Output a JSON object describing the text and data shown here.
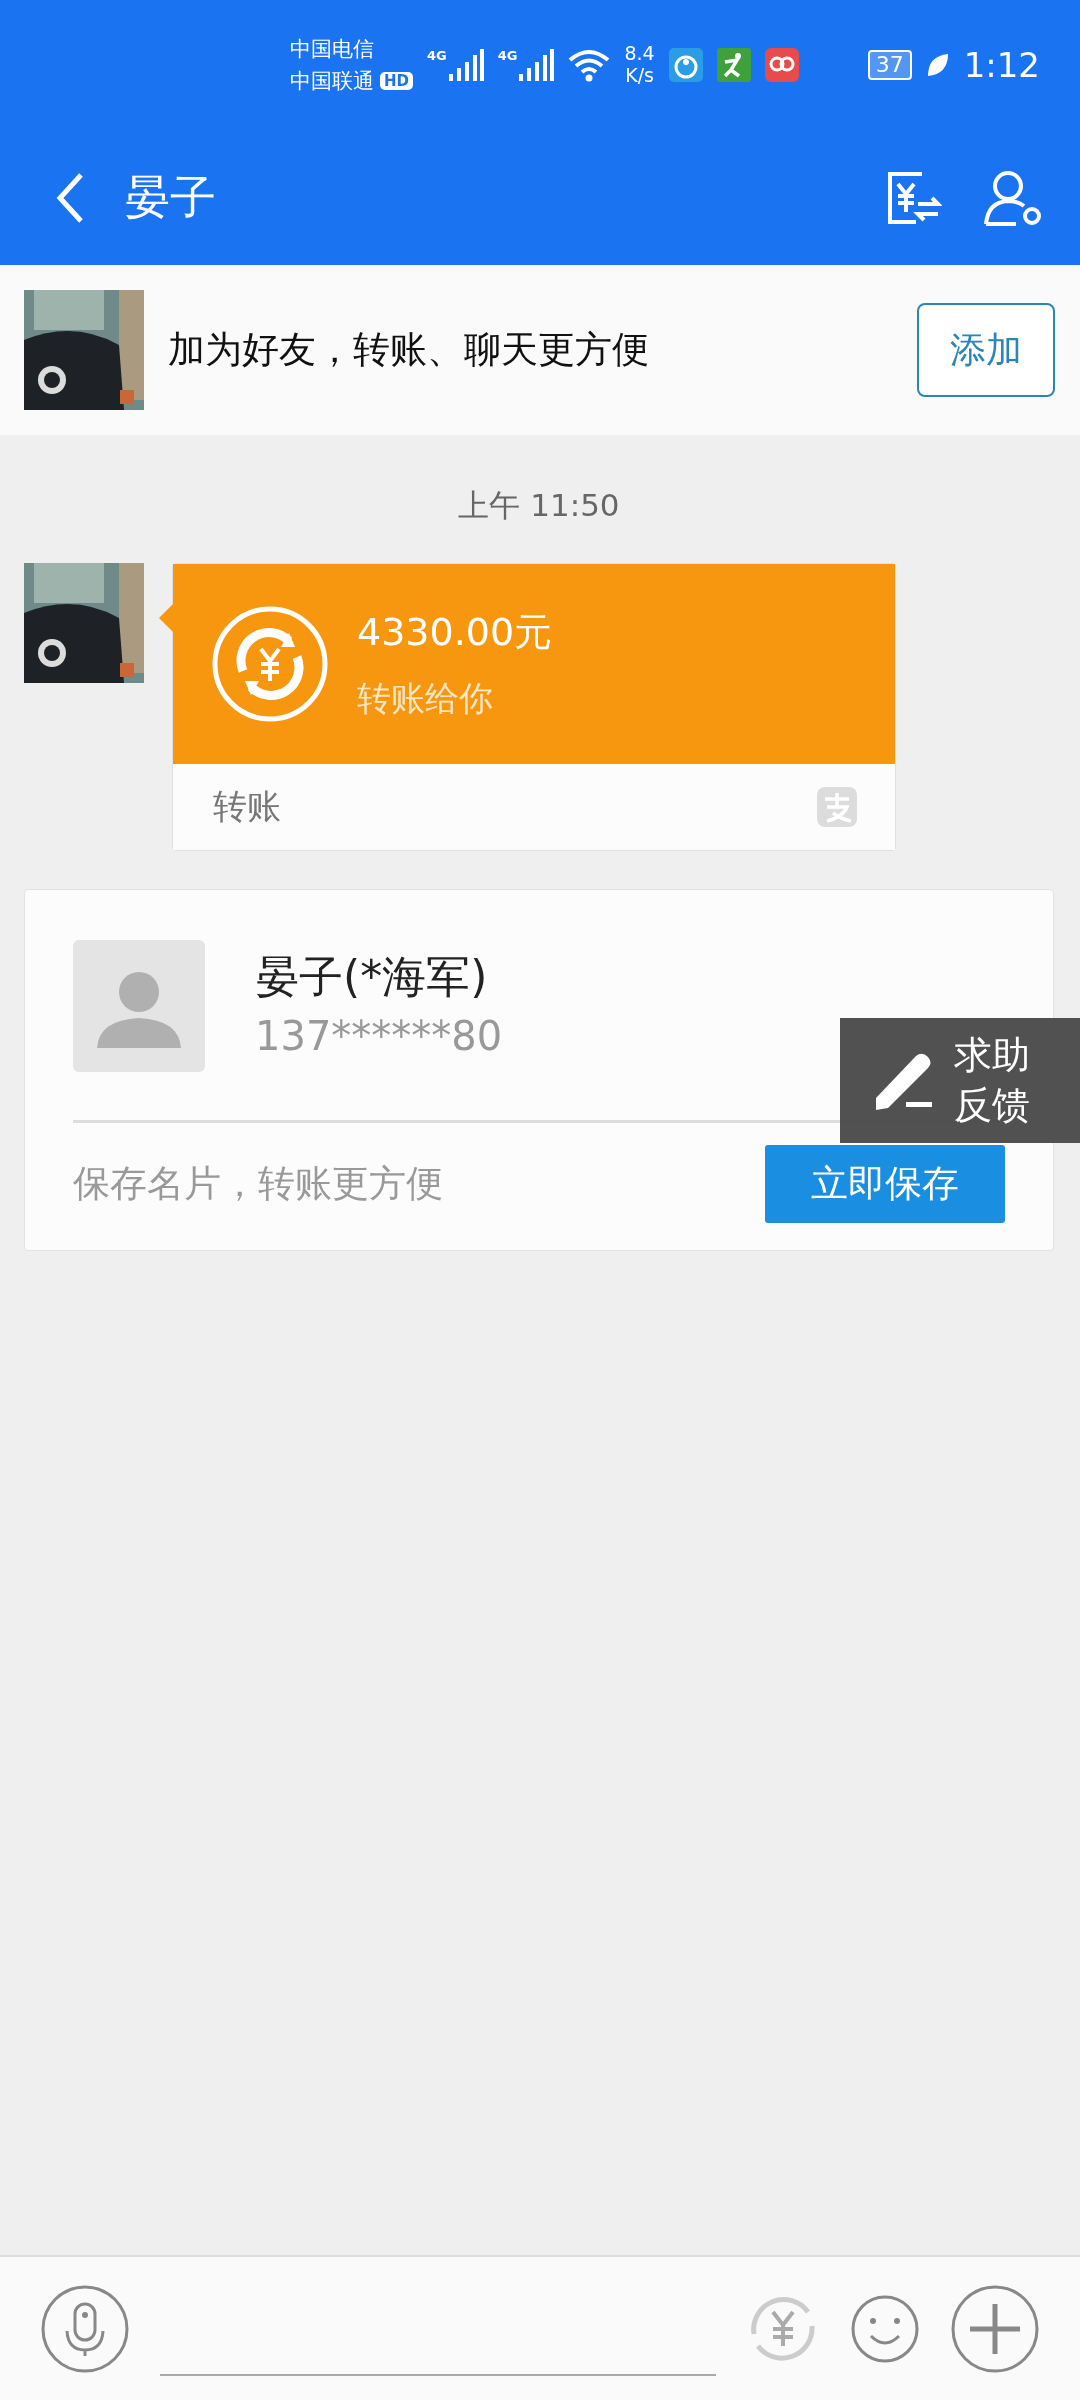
{
  "status_bar": {
    "carriers": [
      "中国电信",
      "中国联通"
    ],
    "hd_badge": "HD",
    "network_labels": [
      "4G",
      "4G"
    ],
    "speed": [
      "8.4",
      "K/s"
    ],
    "battery": "37",
    "time": "1:12"
  },
  "header": {
    "title": "晏子"
  },
  "friend_banner": {
    "text": "加为好友，转账、聊天更方便",
    "button": "添加"
  },
  "messages": [
    {
      "kind": "time",
      "text": "上午 11:50"
    },
    {
      "kind": "transfer",
      "amount": "4330.00元",
      "note": "转账给你",
      "footer": "转账"
    }
  ],
  "contact_card": {
    "name": "晏子(*海军)",
    "phone": "137******80",
    "hint": "保存名片，转账更方便",
    "button": "立即保存"
  },
  "feedback_float": {
    "lines": [
      "求助",
      "反馈"
    ]
  }
}
